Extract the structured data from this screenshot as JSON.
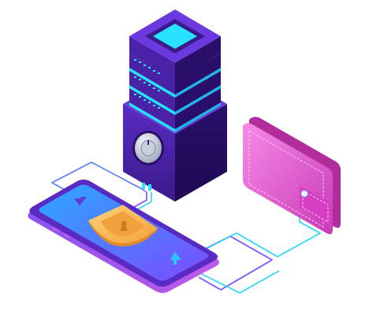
{
  "illustration": {
    "objects": [
      {
        "name": "server-tower",
        "icon": "server-icon"
      },
      {
        "name": "combination-lock-dial",
        "icon": "lock-dial-icon"
      },
      {
        "name": "smartphone",
        "icon": "smartphone-icon"
      },
      {
        "name": "security-shield",
        "icon": "shield-keyhole-icon"
      },
      {
        "name": "wallet",
        "icon": "wallet-icon"
      },
      {
        "name": "connection-wires",
        "icon": "network-lines"
      }
    ],
    "colors": {
      "background": "#ffffff",
      "server_dark": "#3b1a8a",
      "server_mid": "#5a2bc2",
      "server_light": "#7a45e0",
      "server_glow_cyan": "#27e3ff",
      "wallet_pink": "#e24fcf",
      "wallet_pink_light": "#f58be6",
      "wallet_pink_dark": "#b02d9b",
      "phone_body": "#6a3bd6",
      "phone_screen_top": "#2ca8ff",
      "phone_screen_bottom": "#7a4bff",
      "shield_orange": "#f2a23c",
      "shield_orange_light": "#ffd27a",
      "wire_blue": "#5a7bff",
      "wire_cyan": "#27d6ff",
      "wire_purple": "#7a4bff",
      "arrow_purple": "#5a3bd6",
      "arrow_cyan": "#2cc6ff"
    }
  }
}
